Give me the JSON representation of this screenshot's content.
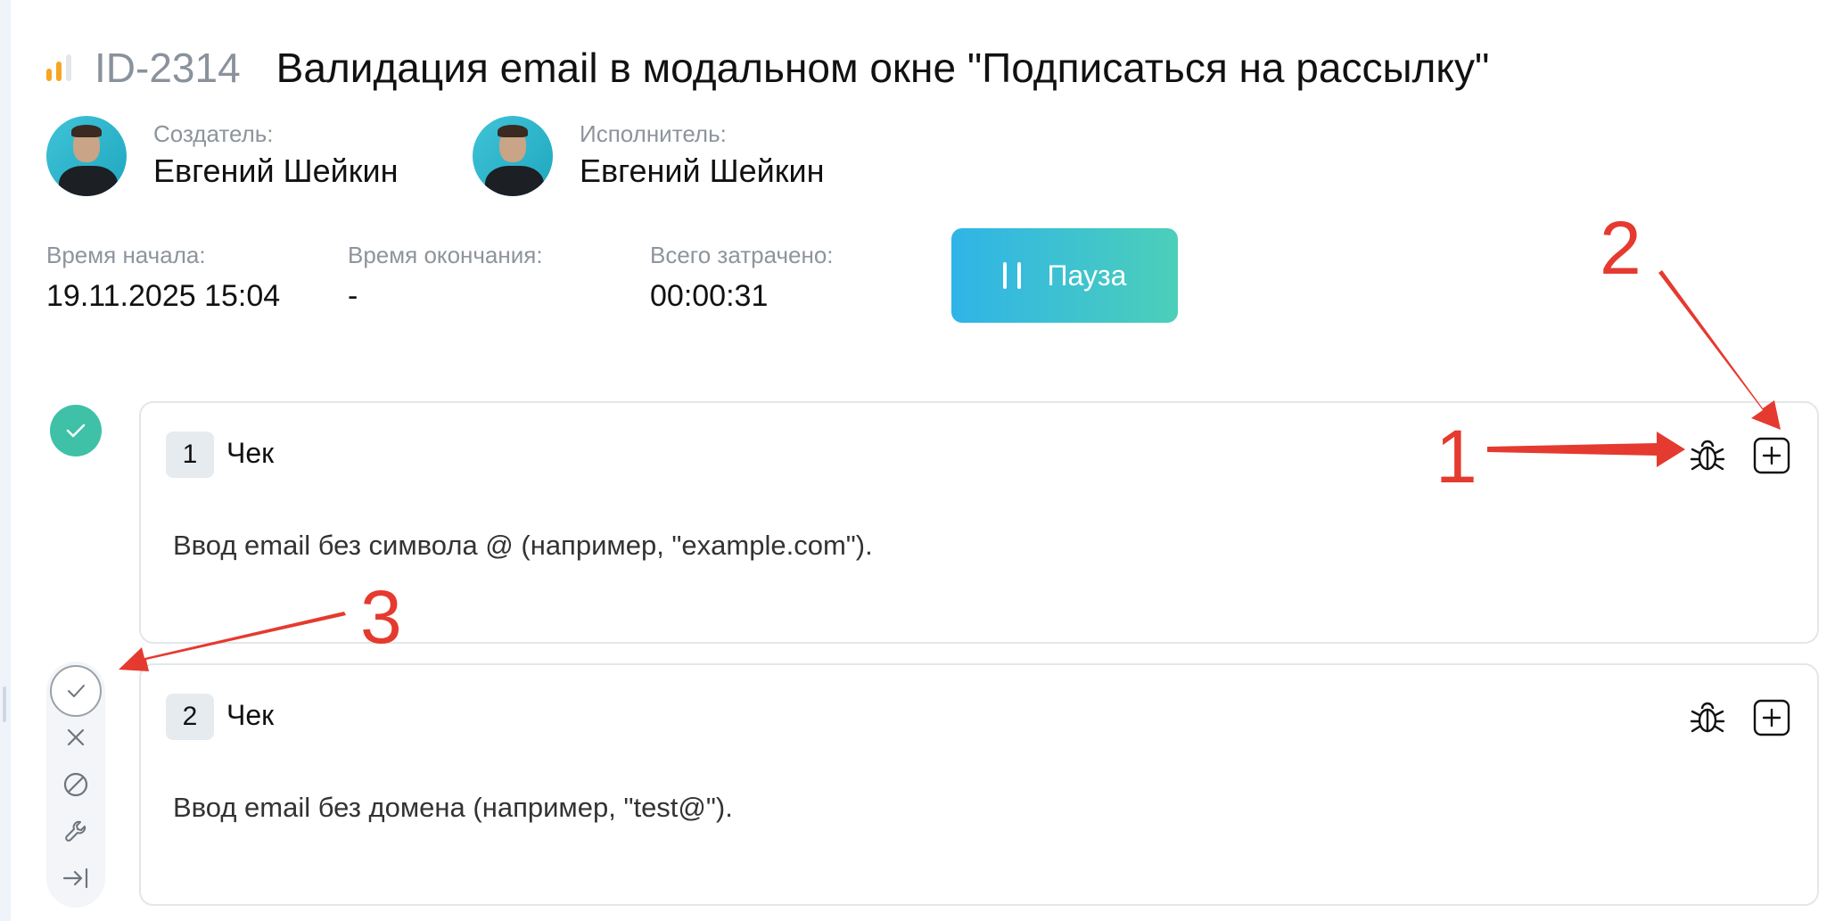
{
  "task": {
    "id": "ID-2314",
    "title": "Валидация email в модальном окне \"Подписаться на рассылку\"",
    "priority_colors": [
      "#f5a623",
      "#f5a623",
      "#e3e6ea"
    ]
  },
  "people": {
    "creator": {
      "role": "Создатель:",
      "name": "Евгений Шейкин"
    },
    "assignee": {
      "role": "Исполнитель:",
      "name": "Евгений Шейкин"
    }
  },
  "timing": {
    "start_label": "Время начала:",
    "start_value": "19.11.2025 15:04",
    "end_label": "Время окончания:",
    "end_value": "-",
    "total_label": "Всего затрачено:",
    "total_value": "00:00:31"
  },
  "pause_button": {
    "label": "Пауза"
  },
  "checks": [
    {
      "number": "1",
      "label": "Чек",
      "text": "Ввод email без символа @ (например, \"example.com\").",
      "status": "passed"
    },
    {
      "number": "2",
      "label": "Чек",
      "text": "Ввод email без домена (например, \"test@\").",
      "status": "pending"
    }
  ],
  "status_actions": [
    "check-icon",
    "close-icon",
    "block-icon",
    "wrench-icon",
    "skip-icon"
  ],
  "card_actions": [
    "bug-icon",
    "add-square-icon"
  ],
  "annotations": {
    "one": "1",
    "two": "2",
    "three": "3"
  },
  "colors": {
    "accent_gradient_start": "#2fb4e8",
    "accent_gradient_end": "#4ccfb9",
    "passed": "#3ec1a6",
    "annotation": "#e53a2f"
  }
}
